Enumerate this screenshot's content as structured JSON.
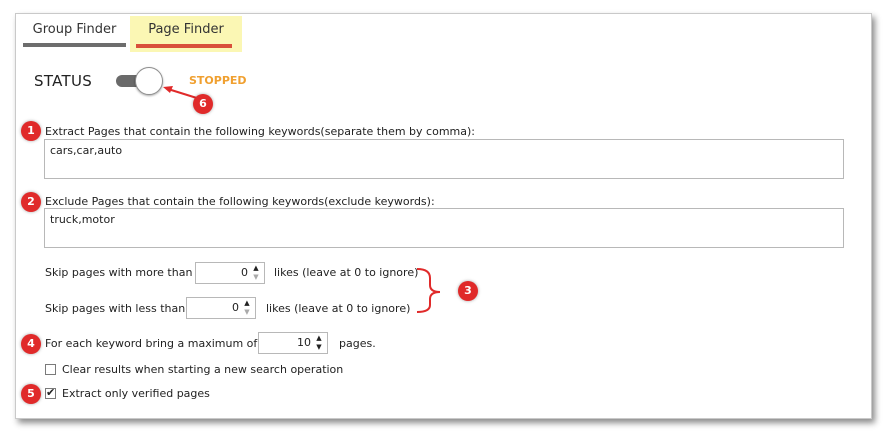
{
  "tabs": [
    {
      "label": "Group Finder"
    },
    {
      "label": "Page Finder"
    }
  ],
  "status": {
    "label": "STATUS",
    "value": "STOPPED",
    "value_color": "#f0a030"
  },
  "extract": {
    "label": "Extract Pages that contain the following keywords(separate them by comma):",
    "value": "cars,car,auto"
  },
  "exclude": {
    "label": "Exclude Pages that contain the following keywords(exclude keywords):",
    "value": "truck,motor"
  },
  "skip_more": {
    "label": "Skip pages with more than",
    "value": "0",
    "suffix": "likes (leave at 0 to ignore)"
  },
  "skip_less": {
    "label": "Skip pages with less than",
    "value": "0",
    "suffix": "likes (leave at 0 to ignore)"
  },
  "max_per_keyword": {
    "label": "For each keyword bring a maximum of",
    "value": "10",
    "suffix": "pages."
  },
  "clear_results": {
    "label": "Clear results when starting a new search operation",
    "checked": false
  },
  "verified_only": {
    "label": "Extract only verified pages",
    "checked": true
  },
  "callouts": [
    "1",
    "2",
    "3",
    "4",
    "5",
    "6"
  ],
  "colors": {
    "accent_tab": "#d9503a",
    "tab_highlight": "#fbf7b4",
    "callout": "#e02a2a"
  }
}
